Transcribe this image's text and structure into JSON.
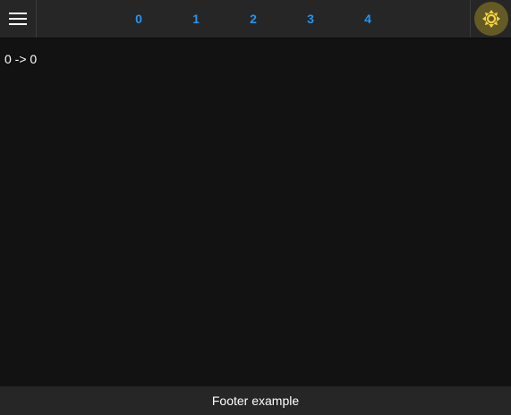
{
  "header": {
    "menu_icon": "hamburger-menu-icon",
    "tabs": [
      {
        "label": "0"
      },
      {
        "label": "1"
      },
      {
        "label": "2"
      },
      {
        "label": "3"
      },
      {
        "label": "4"
      }
    ],
    "theme_icon": "sun-icon"
  },
  "main": {
    "text": "0 -> 0"
  },
  "footer": {
    "text": "Footer example"
  },
  "colors": {
    "background": "#121212",
    "bar": "#262626",
    "tab_text": "#2196f3",
    "theme_button_bg": "#635a25",
    "sun_icon": "#f5d33c"
  }
}
